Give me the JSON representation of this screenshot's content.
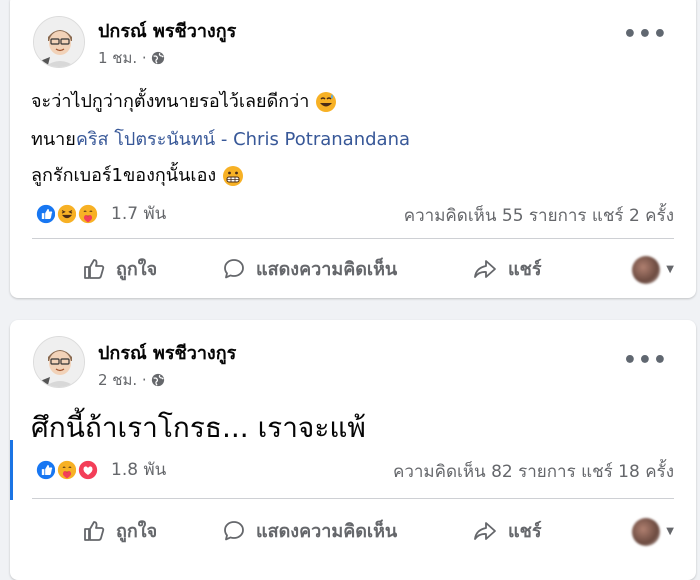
{
  "posts": [
    {
      "author": "ปกรณ์ พรชีวางกูร",
      "time": "1 ชม. ·",
      "lines": {
        "line1": "จะว่าไปกูว่ากุตั้งทนายรอไว้เลยดีกว่า",
        "lawyer_prefix": "ทนาย",
        "lawyer_link": "คริส โปตระนันทน์ - Chris Potranandana",
        "line3": "ลูกรักเบอร์1ของกุนั้นเอง"
      },
      "reactions": [
        "like",
        "haha",
        "care"
      ],
      "reaction_count": "1.7 พัน",
      "stats": "ความคิดเห็น 55 รายการ  แชร์ 2 ครั้ง",
      "actions": {
        "like": "ถูกใจ",
        "comment": "แสดงความคิดเห็น",
        "share": "แชร์"
      }
    },
    {
      "author": "ปกรณ์ พรชีวางกูร",
      "time": "2 ชม. ·",
      "text": "ศึกนี้ถ้าเราโกรธ... เราจะแพ้",
      "reactions": [
        "like",
        "care",
        "love"
      ],
      "reaction_count": "1.8 พัน",
      "stats": "ความคิดเห็น 82 รายการ  แชร์ 18 ครั้ง",
      "actions": {
        "like": "ถูกใจ",
        "comment": "แสดงความคิดเห็น",
        "share": "แชร์"
      }
    }
  ],
  "colors": {
    "link": "#385898",
    "secondary_text": "#65676b",
    "like_blue": "#1877f2",
    "love_red": "#f33e58",
    "emoji_yellow": "#f7b125"
  }
}
